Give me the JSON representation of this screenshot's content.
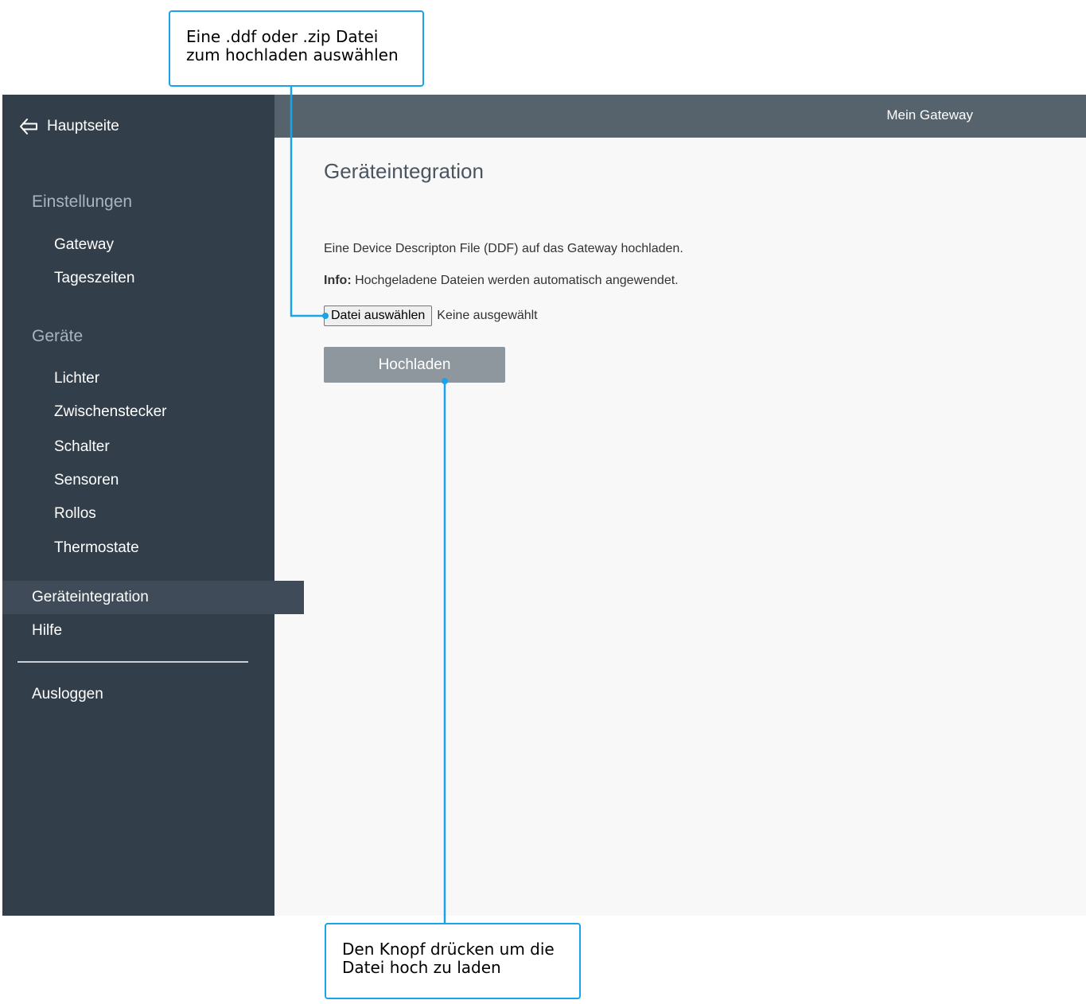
{
  "sidebar": {
    "home_label": "Hauptseite",
    "sections": {
      "settings": "Einstellungen",
      "devices": "Geräte"
    },
    "settings_items": [
      "Gateway",
      "Tageszeiten"
    ],
    "device_items": [
      "Lichter",
      "Zwischenstecker",
      "Schalter",
      "Sensoren",
      "Rollos",
      "Thermostate"
    ],
    "integration": "Geräteintegration",
    "help": "Hilfe",
    "logout": "Ausloggen"
  },
  "topbar": {
    "gateway_name": "Mein Gateway"
  },
  "main": {
    "title": "Geräteintegration",
    "description": "Eine Device Descripton File (DDF) auf das Gateway hochladen.",
    "info_label": "Info:",
    "info_text": " Hochgeladene Dateien werden automatisch angewendet.",
    "file_button_label": "Datei auswählen",
    "file_status": "Keine ausgewählt",
    "upload_label": "Hochladen"
  },
  "callouts": {
    "top_line1": "Eine .ddf oder .zip Datei",
    "top_line2": "zum hochladen auswählen",
    "bottom_line1": "Den Knopf drücken um die",
    "bottom_line2": "Datei hoch zu laden"
  },
  "colors": {
    "sidebar_bg": "#323e4a",
    "topbar_bg": "#56636c",
    "upload_button_bg": "#8e979e",
    "callout_accent": "#1aa3e8"
  },
  "icons": {
    "home": "arrow-left-icon"
  }
}
